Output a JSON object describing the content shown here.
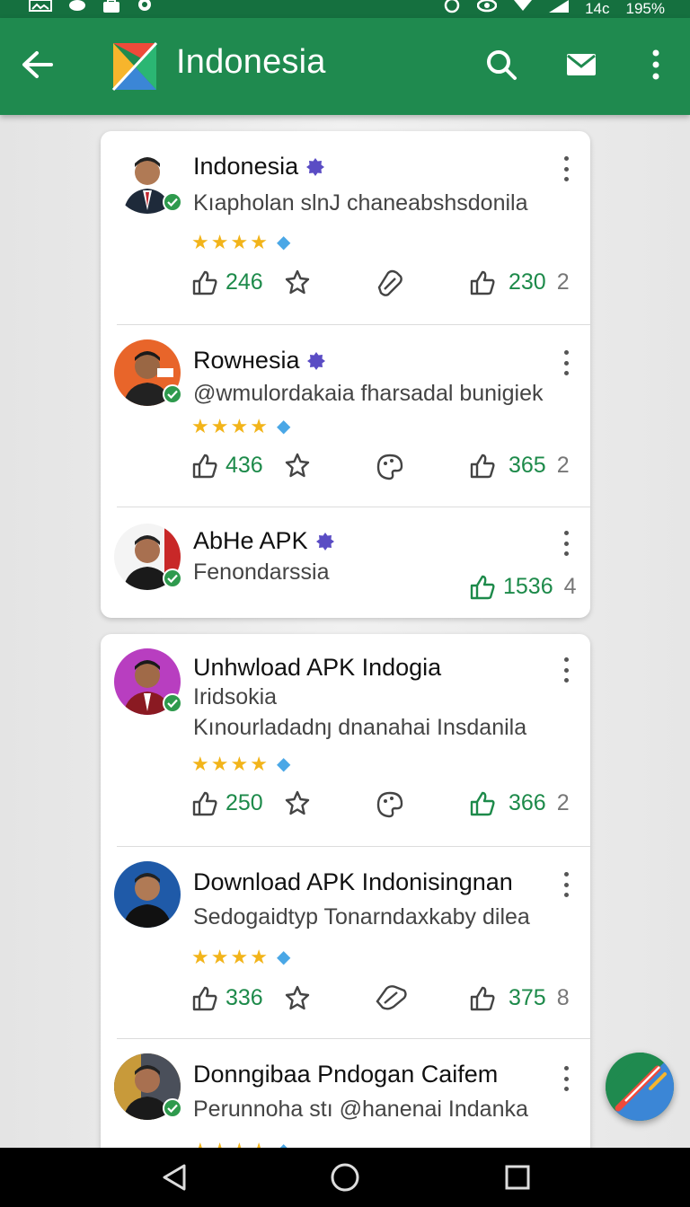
{
  "status_bar": {
    "left_icons": [
      "image-icon",
      "chat-bubble-icon",
      "briefcase-icon",
      "location-pin-icon"
    ],
    "right_icons": [
      "circle-icon",
      "eye-icon",
      "wifi-icon",
      "signal-icon"
    ],
    "signal_text": "14c",
    "battery_text": "195%"
  },
  "app_bar": {
    "title": "Indonesia",
    "back_icon": "arrow-left-icon",
    "search_icon": "search-icon",
    "mail_icon": "mail-icon",
    "more_icon": "more-vert-icon",
    "colors": {
      "bar": "#1f8a4f",
      "status": "#15703f"
    }
  },
  "cards": [
    {
      "items": [
        {
          "title": "Indonesia",
          "subtitle": "Kıapholan slnJ chaneabshsdonila",
          "stars": 4,
          "like_left": "246",
          "like_right": "230",
          "trail": "2",
          "avatar_bg": "#ffffff"
        },
        {
          "title": "Rowнesia",
          "subtitle": "@wmulordakaia fharsadal bunigiek",
          "stars": 4,
          "like_left": "436",
          "like_right": "365",
          "trail": "2",
          "avatar_bg": "#e8652a"
        },
        {
          "title": "AbHe APK",
          "subtitle": "Fenondarssia",
          "like_right": "1536",
          "trail": "4",
          "avatar_bg": "#f4f4f4"
        }
      ]
    },
    {
      "items": [
        {
          "title": "Unhwload APK Indogia",
          "subtitle": "Iridsokia",
          "subtitle2": "Kınourladadnȷ dnanahai Insdanila",
          "stars": 4,
          "like_left": "250",
          "like_right": "366",
          "trail": "2",
          "avatar_bg": "#b83ec0"
        },
        {
          "title": "Download APK Indonisingnan",
          "subtitle": "Sedogaidtyp Tonarndaxkaby dilea",
          "stars": 4,
          "like_left": "336",
          "like_right": "375",
          "trail": "8",
          "avatar_bg": "#1f5aa8"
        },
        {
          "title": "Donngibaa Pndogan Caifem",
          "subtitle": "Perunnoha stı @hanenai Indanka",
          "stars": 4,
          "avatar_bg": "#c89a3a"
        }
      ]
    }
  ],
  "fab": {
    "icon": "edit-icon"
  },
  "nav_bar": {
    "back": "nav-back-icon",
    "home": "nav-home-icon",
    "recents": "nav-recents-icon"
  }
}
